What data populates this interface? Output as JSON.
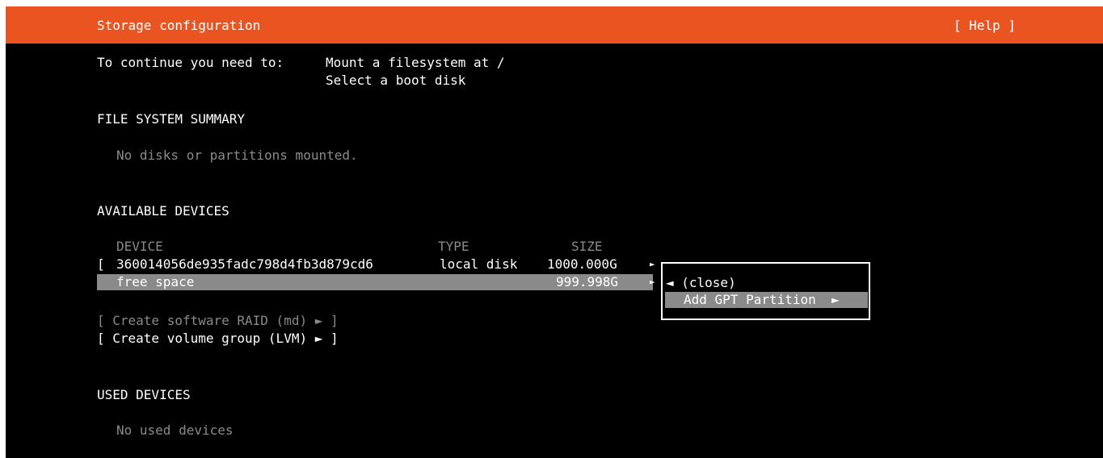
{
  "header": {
    "title": "Storage configuration",
    "help": "[ Help ]"
  },
  "requirements": {
    "prefix": "To continue you need to:",
    "items": [
      "Mount a filesystem at /",
      "Select a boot disk"
    ]
  },
  "file_system_summary": {
    "heading": "FILE SYSTEM SUMMARY",
    "empty_text": "No disks or partitions mounted."
  },
  "available_devices": {
    "heading": "AVAILABLE DEVICES",
    "columns": {
      "device": "DEVICE",
      "type": "TYPE",
      "size": "SIZE"
    },
    "disk": {
      "bracket": "[",
      "name": "360014056de935fadc798d4fb3d879cd6",
      "type": "local disk",
      "size": "1000.000G",
      "arrow": "►"
    },
    "free_space": {
      "name": "free space",
      "size": "999.998G",
      "arrow": "►"
    },
    "actions": {
      "raid": "[ Create software RAID (md) ► ]",
      "lvm": "[ Create volume group (LVM) ► ]"
    }
  },
  "context_menu": {
    "close": "◄ (close)",
    "add_gpt": "Add GPT Partition  ►"
  },
  "used_devices": {
    "heading": "USED DEVICES",
    "empty_text": "No used devices"
  },
  "colors": {
    "accent": "#e95420",
    "background": "#000000",
    "text": "#ffffff",
    "dim_text": "#8a8a8a",
    "highlight": "#8a8a8a"
  }
}
